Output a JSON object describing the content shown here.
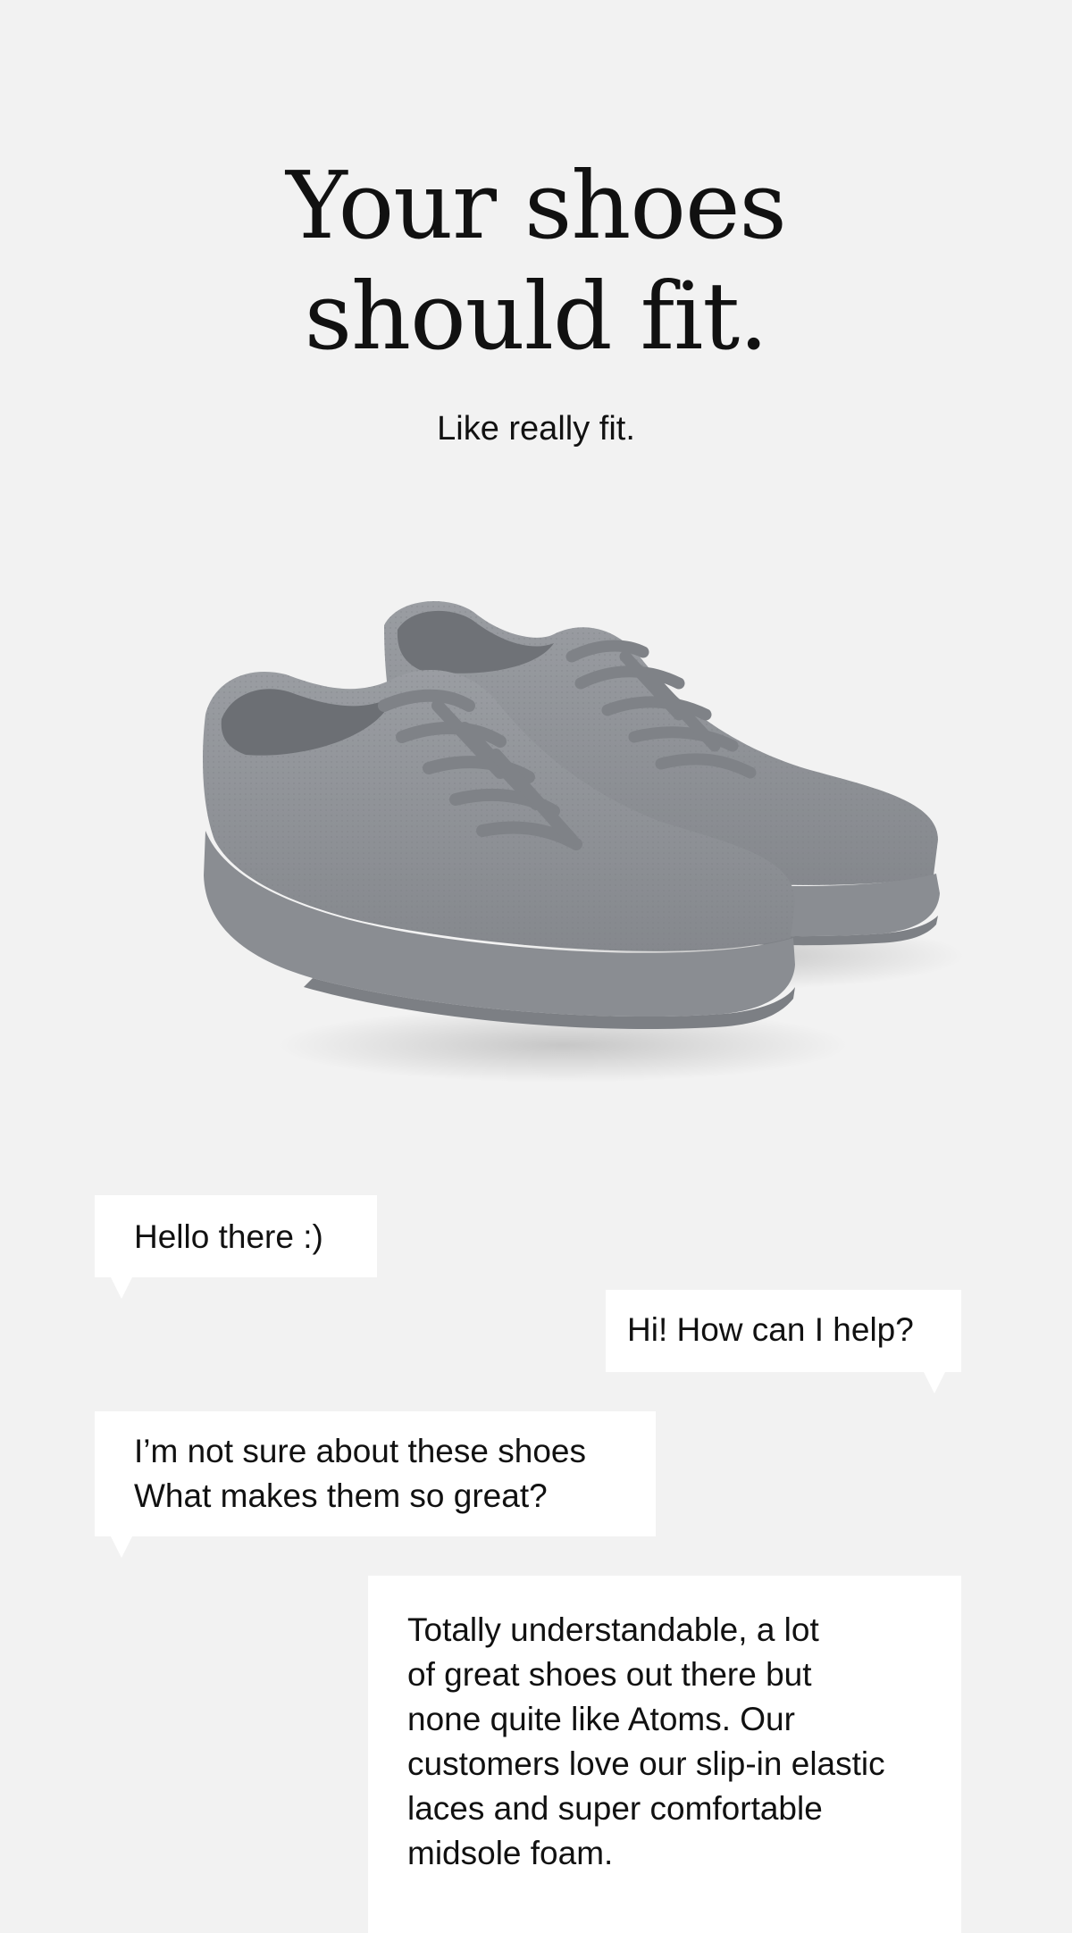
{
  "hero": {
    "headline_line1": "Your shoes",
    "headline_line2": "should fit.",
    "subhead": "Like really fit."
  },
  "product": {
    "image_icon": "sneakers-pair",
    "shoe_color": "#8e9196",
    "sole_color": "#8a8d92"
  },
  "chat": {
    "bubbles": [
      {
        "side": "left",
        "lines": [
          "Hello there :)"
        ]
      },
      {
        "side": "right",
        "lines": [
          "Hi! How can I help?"
        ]
      },
      {
        "side": "left",
        "lines": [
          "I’m not sure about these shoes",
          "What makes them so great?"
        ]
      },
      {
        "side": "right",
        "lines": [
          "Totally understandable, a lot",
          "of great shoes out there but",
          "none quite like Atoms. Our",
          "customers love our slip-in elastic",
          "laces and super comfortable",
          "midsole foam."
        ]
      }
    ]
  },
  "colors": {
    "background": "#f2f2f2",
    "bubble": "#ffffff",
    "text": "#111111"
  }
}
